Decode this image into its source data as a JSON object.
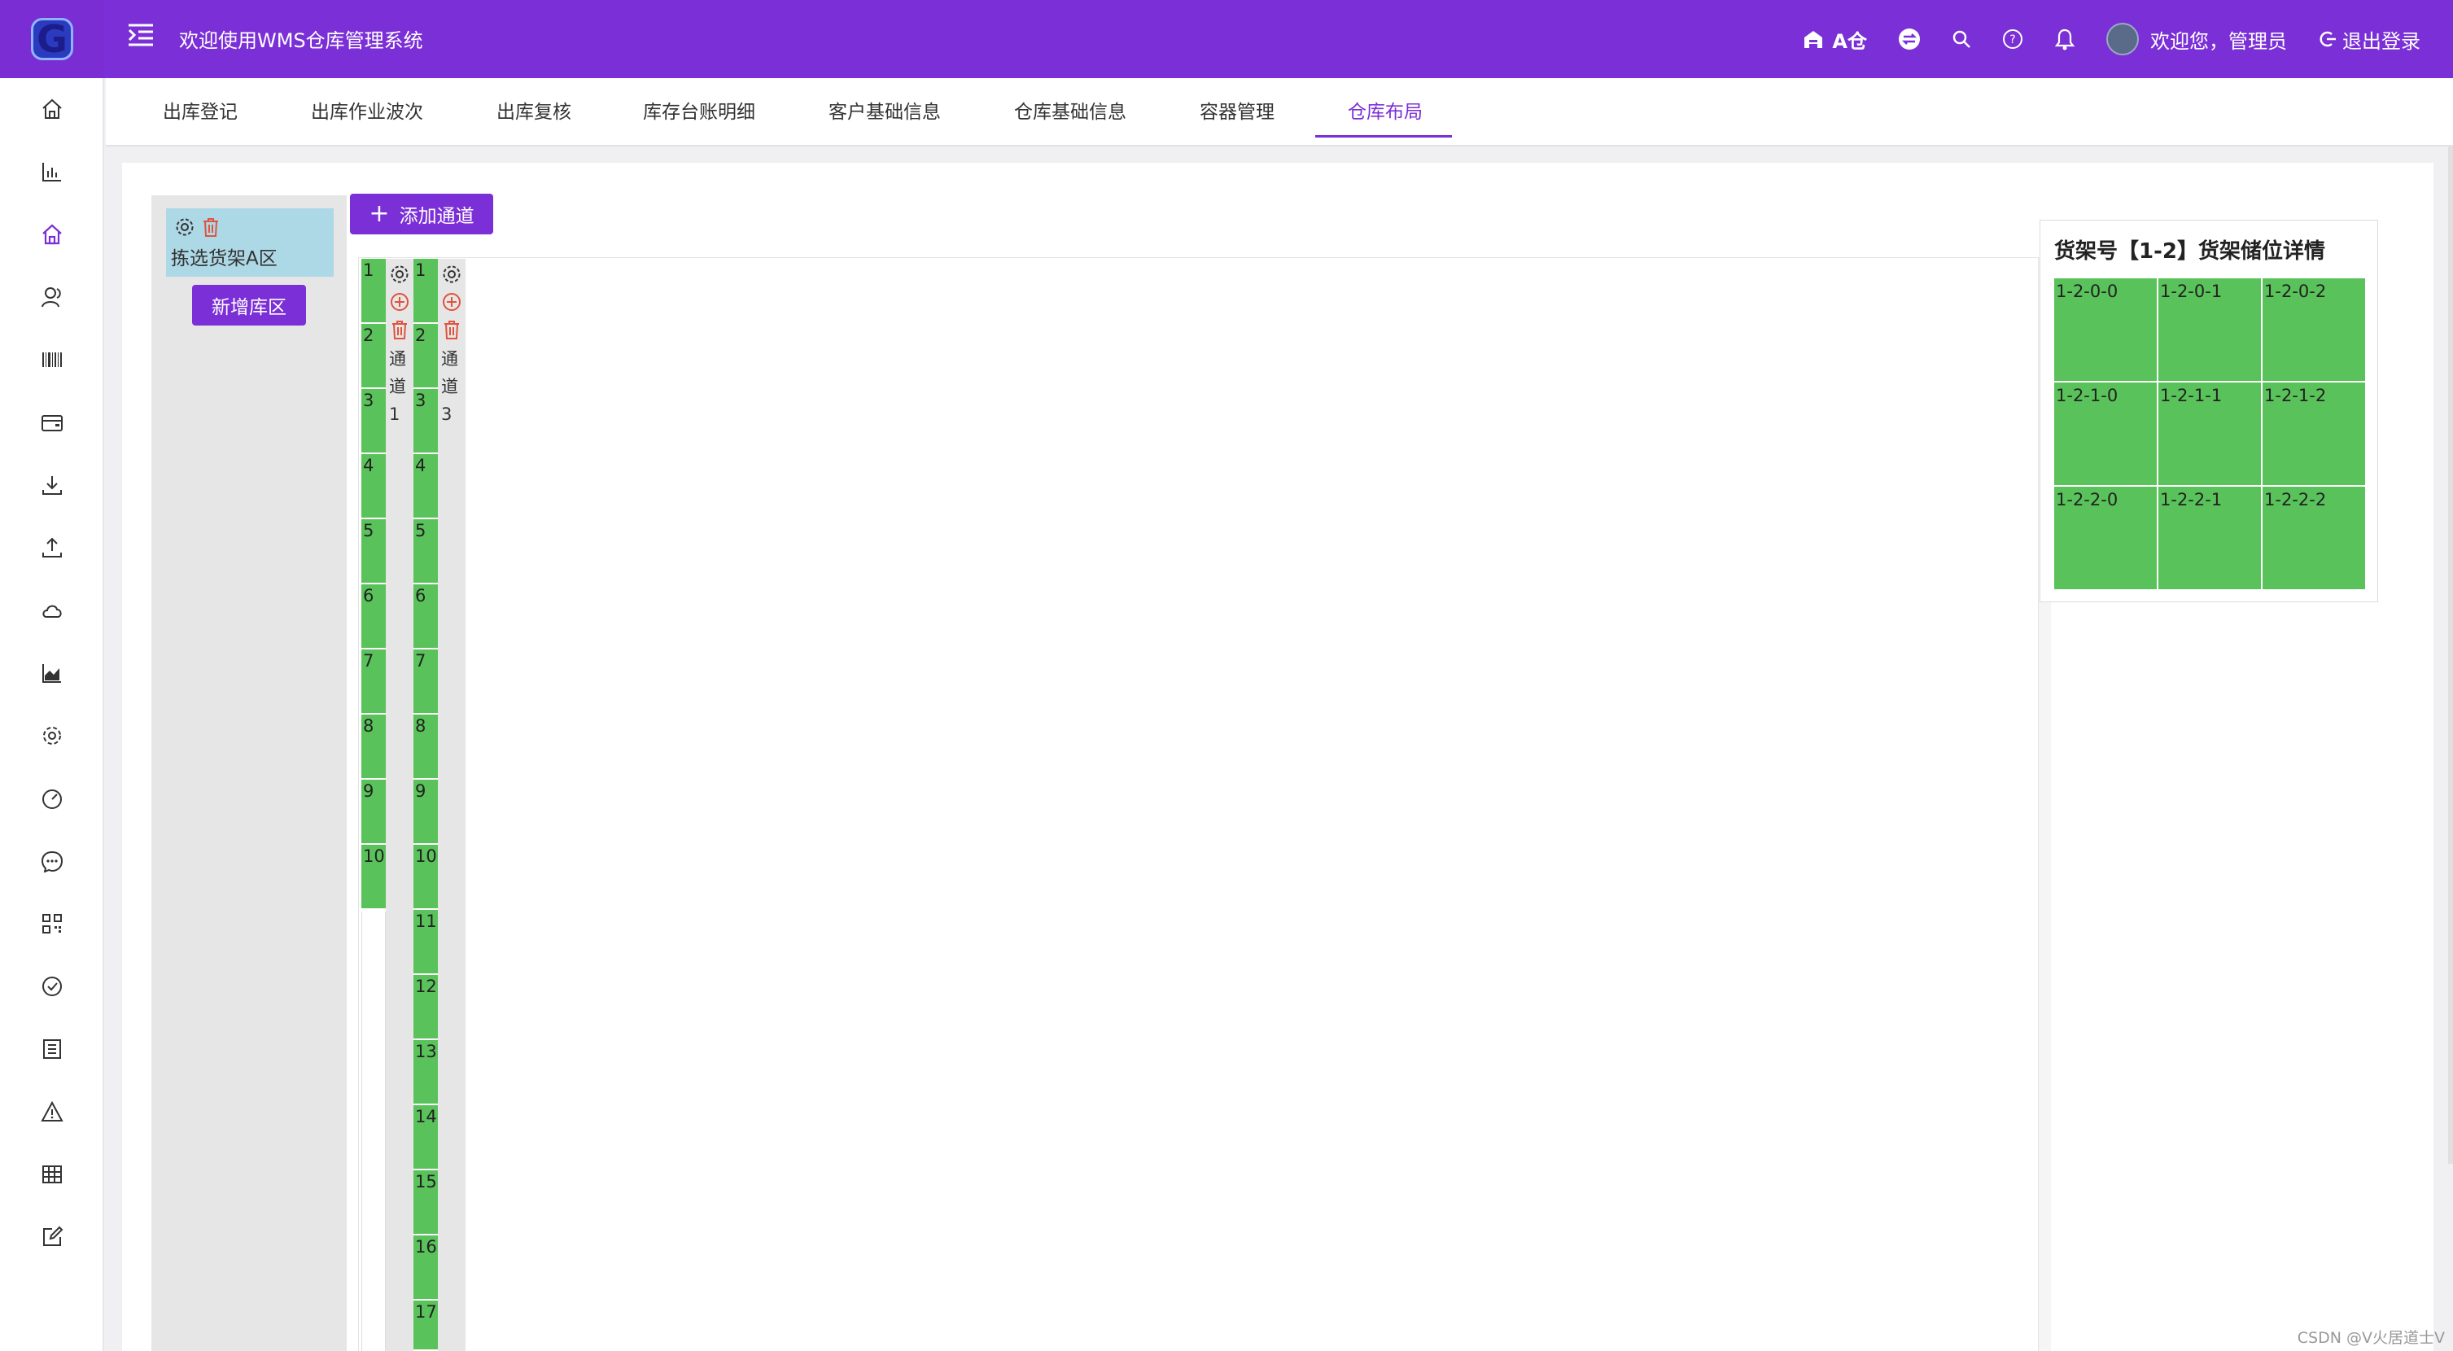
{
  "header": {
    "logo_text": "G",
    "title": "欢迎使用WMS仓库管理系统",
    "warehouse_label": "A仓",
    "user_greeting": "欢迎您，管理员",
    "logout_label": "退出登录"
  },
  "sidebar": {
    "icons": [
      "home-icon",
      "bar-chart-icon",
      "home-active-icon",
      "users-icon",
      "barcode-icon",
      "wallet-icon",
      "download-icon",
      "upload-icon",
      "cloud-icon",
      "area-chart-icon",
      "gear-icon",
      "dashboard-icon",
      "message-icon",
      "qrcode-icon",
      "check-circle-icon",
      "list-icon",
      "warning-icon",
      "table-icon",
      "edit-icon"
    ]
  },
  "tabs": [
    {
      "label": "出库登记"
    },
    {
      "label": "出库作业波次"
    },
    {
      "label": "出库复核"
    },
    {
      "label": "库存台账明细"
    },
    {
      "label": "客户基础信息"
    },
    {
      "label": "仓库基础信息"
    },
    {
      "label": "容器管理"
    },
    {
      "label": "仓库布局"
    }
  ],
  "zones": {
    "items": [
      {
        "label": "拣选货架A区"
      }
    ],
    "add_label": "新增库区"
  },
  "layout": {
    "add_aisle_label": "添加通道",
    "rack1": [
      "1",
      "2",
      "3",
      "4",
      "5",
      "6",
      "7",
      "8",
      "9",
      "10"
    ],
    "aisle1": [
      "通",
      "道",
      "1"
    ],
    "rack2": [
      "1",
      "2",
      "3",
      "4",
      "5",
      "6",
      "7",
      "8",
      "9",
      "10",
      "11",
      "12",
      "13",
      "14",
      "15",
      "16",
      "17"
    ],
    "aisle3": [
      "通",
      "道",
      "3"
    ]
  },
  "detail": {
    "title": "货架号【1-2】货架储位详情",
    "slots": [
      "1-2-0-0",
      "1-2-0-1",
      "1-2-0-2",
      "1-2-1-0",
      "1-2-1-1",
      "1-2-1-2",
      "1-2-2-0",
      "1-2-2-1",
      "1-2-2-2"
    ]
  },
  "watermark": "CSDN @V火居道士V",
  "colors": {
    "primary": "#7b2fd6",
    "slot_green": "#5ac25a",
    "zone_blue": "#add8e6",
    "delete_red": "#e0533e"
  }
}
